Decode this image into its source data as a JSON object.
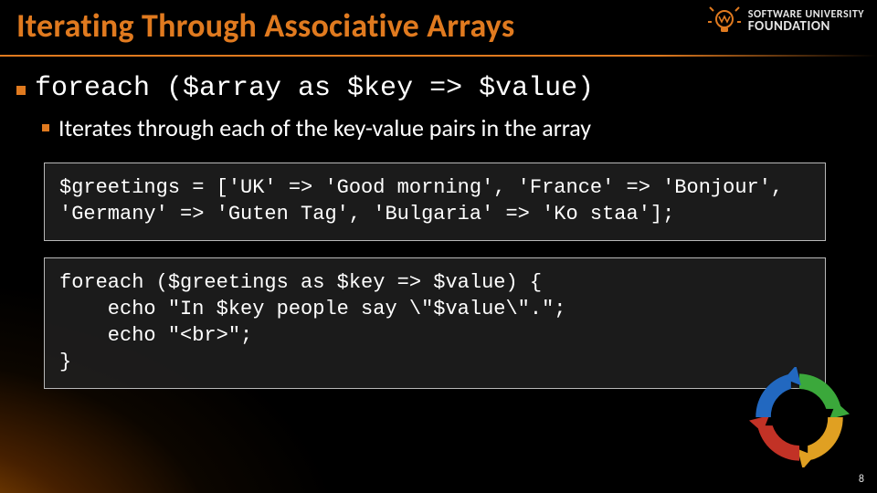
{
  "title": "Iterating Through Associative Arrays",
  "logo": {
    "line1": "SOFTWARE UNIVERSITY",
    "line2": "FOUNDATION"
  },
  "bullet1": "foreach ($array as $key => $value)",
  "bullet2": "Iterates through each of the key-value pairs in the array",
  "code1": "$greetings = ['UK' => 'Good morning', 'France' => 'Bonjour',\n'Germany' => 'Guten Tag', 'Bulgaria' => 'Ko staa'];",
  "code2": "foreach ($greetings as $key => $value) {\n    echo \"In $key people say \\\"$value\\\".\";\n    echo \"<br>\";\n}",
  "page_number": "8"
}
